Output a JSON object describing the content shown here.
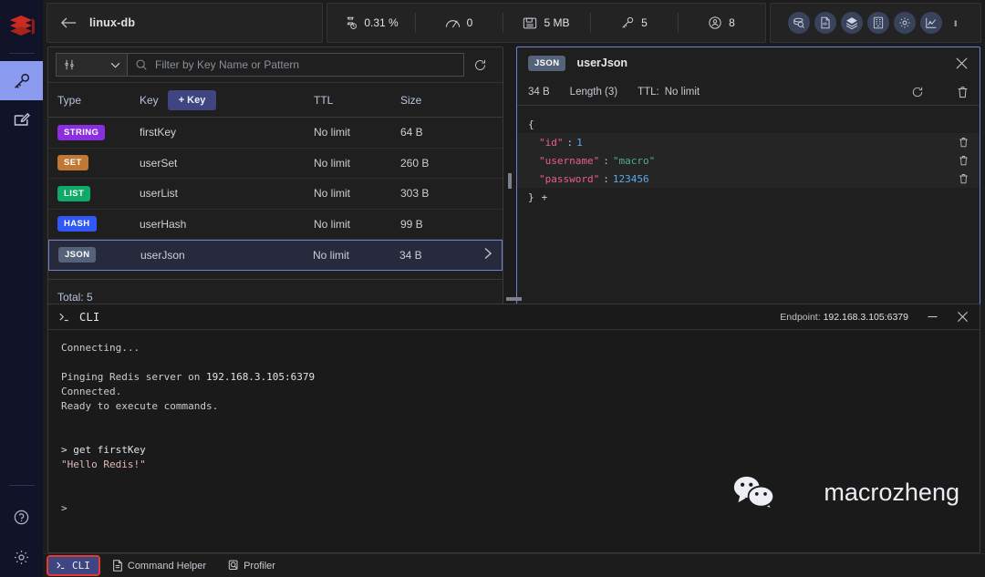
{
  "rail": {
    "logo": "redis-logo",
    "items": [
      {
        "name": "browser",
        "icon": "key-icon",
        "active": true
      },
      {
        "name": "workbench",
        "icon": "edit-note-icon",
        "active": false
      }
    ],
    "bottom": [
      {
        "name": "help",
        "icon": "question-circle-icon"
      },
      {
        "name": "settings",
        "icon": "gear-icon"
      }
    ]
  },
  "topbar": {
    "back_label": "back",
    "db_name": "linux-db",
    "stats": [
      {
        "icon": "cpu-icon",
        "value": "0.31 %"
      },
      {
        "icon": "gauge-icon",
        "value": "0"
      },
      {
        "icon": "memory-icon",
        "value": "5 MB"
      },
      {
        "icon": "key-icon",
        "value": "5"
      },
      {
        "icon": "user-icon",
        "value": "8"
      }
    ],
    "tools": [
      {
        "name": "database-analysis",
        "icon": "db-analysis-icon"
      },
      {
        "name": "slow-log",
        "icon": "document-icon"
      },
      {
        "name": "pub-sub",
        "icon": "layers-icon"
      },
      {
        "name": "memory-usage",
        "icon": "grid-icon"
      },
      {
        "name": "configuration",
        "icon": "gear-icon"
      },
      {
        "name": "charts",
        "icon": "chart-line-icon"
      },
      {
        "name": "more",
        "icon": "dots-vertical-icon"
      }
    ]
  },
  "browser": {
    "filter": {
      "select_value": "",
      "select_icon": "filter-sliders-icon",
      "placeholder": "Filter by Key Name or Pattern",
      "search_icon": "search-icon",
      "refresh_icon": "refresh-icon"
    },
    "columns": {
      "type": "Type",
      "key": "Key",
      "add_key": "+ Key",
      "ttl": "TTL",
      "size": "Size"
    },
    "rows": [
      {
        "type": "STRING",
        "color": "#8b2ee0",
        "key": "firstKey",
        "ttl": "No limit",
        "size": "64 B",
        "selected": false
      },
      {
        "type": "SET",
        "color": "#c07834",
        "key": "userSet",
        "ttl": "No limit",
        "size": "260 B",
        "selected": false
      },
      {
        "type": "LIST",
        "color": "#0fa968",
        "key": "userList",
        "ttl": "No limit",
        "size": "303 B",
        "selected": false
      },
      {
        "type": "HASH",
        "color": "#3058f7",
        "key": "userHash",
        "ttl": "No limit",
        "size": "99 B",
        "selected": false
      },
      {
        "type": "JSON",
        "color": "#55637a",
        "key": "userJson",
        "ttl": "No limit",
        "size": "34 B",
        "selected": true
      }
    ],
    "total_label": "Total: 5"
  },
  "detail": {
    "type_badge": "JSON",
    "key_name": "userJson",
    "close_icon": "close-icon",
    "size": "34 B",
    "length": "Length (3)",
    "ttl_label": "TTL:",
    "ttl_value": "No limit",
    "refresh_icon": "refresh-icon",
    "delete_icon": "trash-icon",
    "json": {
      "open_brace": "{",
      "close_brace": "}",
      "add_symbol": "+",
      "entries": [
        {
          "key": "\"id\"",
          "sep": ":",
          "value": "1",
          "kind": "number"
        },
        {
          "key": "\"username\"",
          "sep": ":",
          "value": "\"macro\"",
          "kind": "string"
        },
        {
          "key": "\"password\"",
          "sep": ":",
          "value": "123456",
          "kind": "number"
        }
      ]
    }
  },
  "cli": {
    "title": "CLI",
    "prompt_icon": "terminal-icon",
    "endpoint_label": "Endpoint:",
    "endpoint_value": "192.168.3.105:6379",
    "minimize_icon": "minimize-icon",
    "close_icon": "close-icon",
    "output_connecting": "Connecting...",
    "output_ping_prefix": "Pinging Redis server on ",
    "output_ping_host": "192.168.3.105:6379",
    "output_connected": "Connected.",
    "output_ready": "Ready to execute commands.",
    "command": "> get firstKey",
    "result": "\"Hello Redis!\"",
    "prompt": ">",
    "watermark": "macrozheng",
    "watermark_icon": "wechat-icon"
  },
  "bottom_tabs": [
    {
      "label": "CLI",
      "icon": "terminal-icon",
      "active": true,
      "highlighted": true
    },
    {
      "label": "Command Helper",
      "icon": "document-icon",
      "active": false,
      "highlighted": false
    },
    {
      "label": "Profiler",
      "icon": "profiler-icon",
      "active": false,
      "highlighted": false
    }
  ]
}
